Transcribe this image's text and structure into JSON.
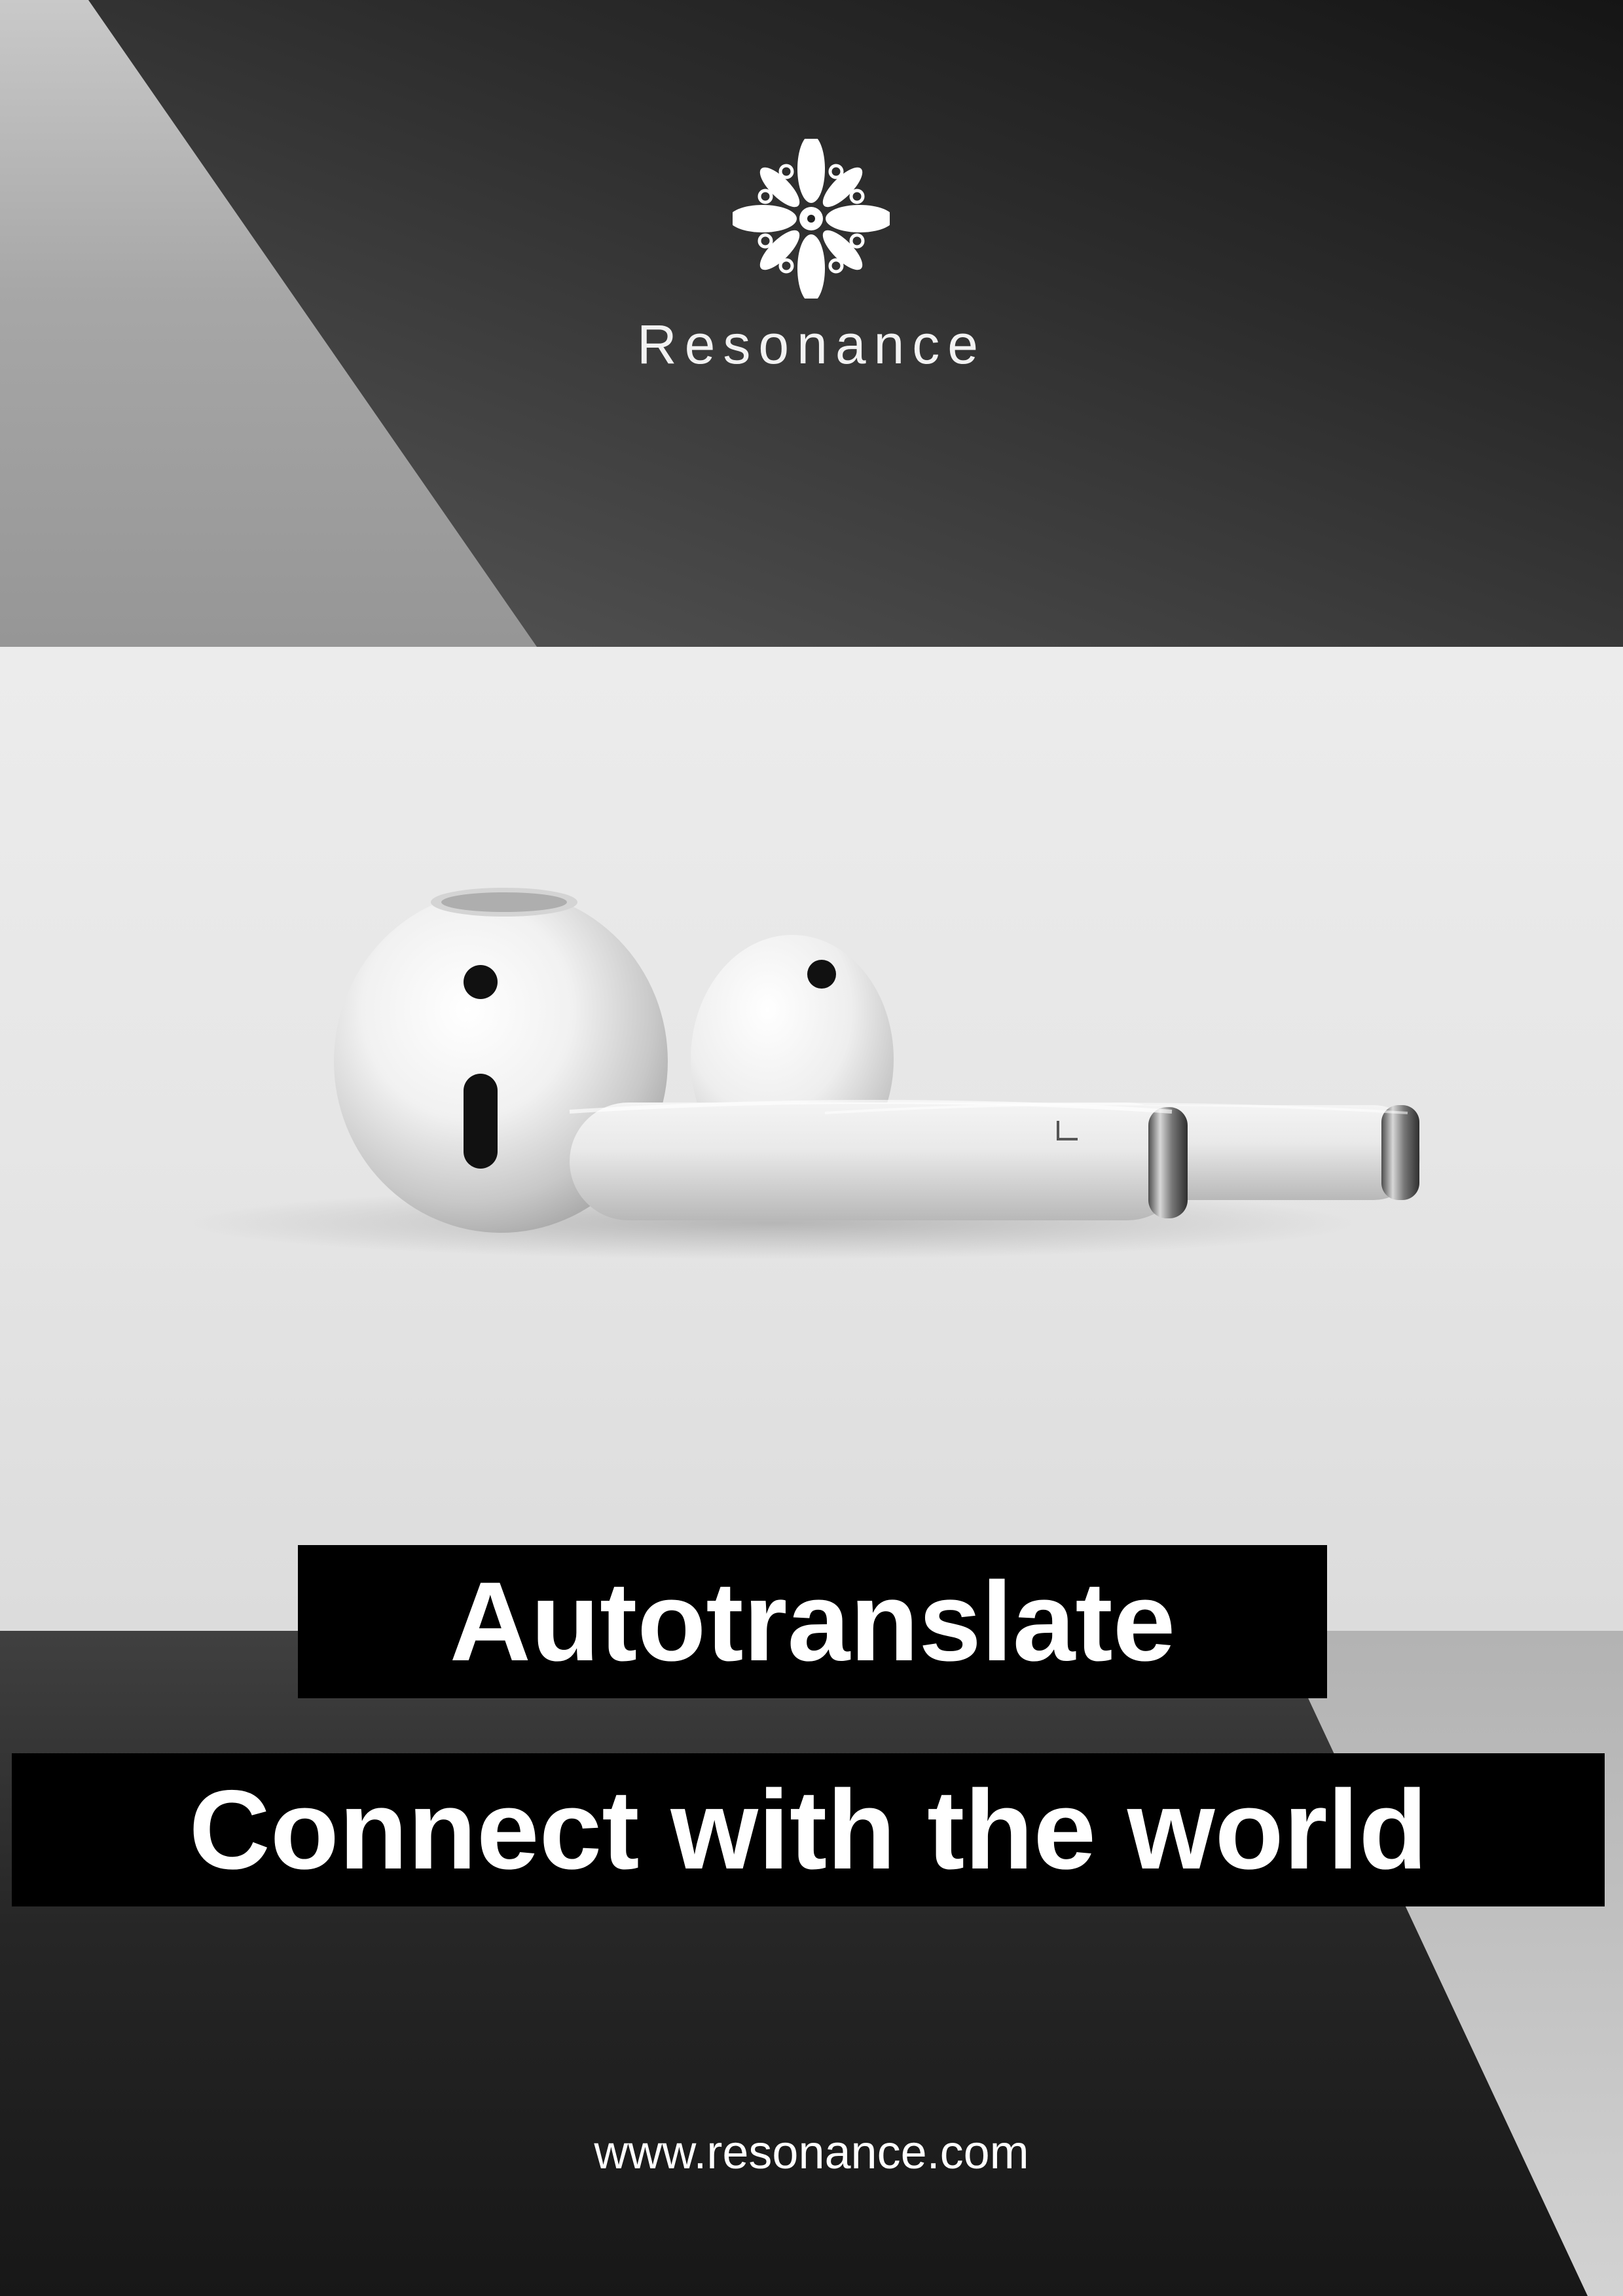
{
  "brand": {
    "name": "Resonance",
    "logo_icon": "floral-logo-icon"
  },
  "headline": {
    "primary": "Autotranslate",
    "secondary": "Connect with the world"
  },
  "footer": {
    "url": "www.resonance.com"
  },
  "colors": {
    "headline_background": "#000000",
    "headline_text": "#ffffff",
    "top_dark": "#151515",
    "top_light": "#969696",
    "photo_background": "#e6e6e6",
    "bottom_dark": "#171717",
    "bottom_light": "#d6d6d6"
  }
}
